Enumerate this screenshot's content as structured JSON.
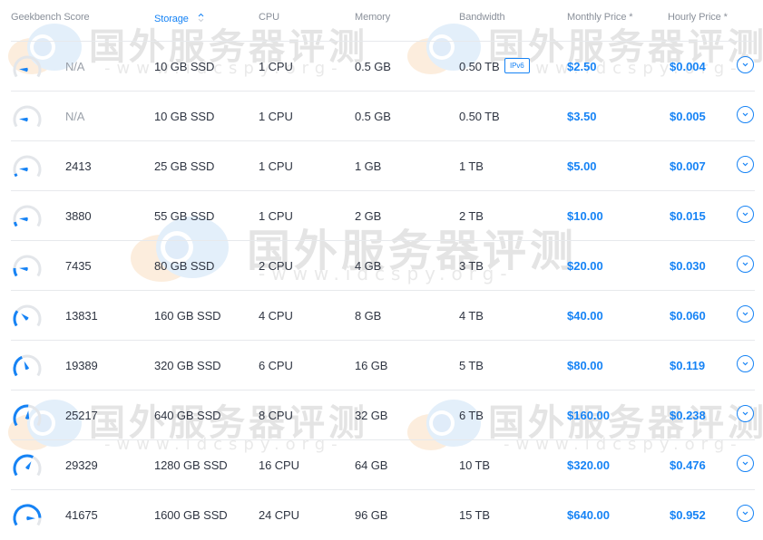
{
  "header": {
    "columns": [
      {
        "label": "Geekbench Score",
        "active": false
      },
      {
        "label": "Storage",
        "active": true,
        "sortable": true
      },
      {
        "label": "CPU",
        "active": false
      },
      {
        "label": "Memory",
        "active": false
      },
      {
        "label": "Bandwidth",
        "active": false
      },
      {
        "label": "Monthly Price *",
        "active": false
      },
      {
        "label": "Hourly Price *",
        "active": false
      }
    ],
    "sort_icon": "sort-updown-icon"
  },
  "rows": [
    {
      "score": "N/A",
      "score_fraction": 0.0,
      "storage": "10 GB SSD",
      "cpu": "1 CPU",
      "memory": "0.5 GB",
      "bandwidth": "0.50 TB",
      "badge": "IPv6",
      "monthly": "$2.50",
      "hourly": "$0.004"
    },
    {
      "score": "N/A",
      "score_fraction": 0.0,
      "storage": "10 GB SSD",
      "cpu": "1 CPU",
      "memory": "0.5 GB",
      "bandwidth": "0.50 TB",
      "badge": "",
      "monthly": "$3.50",
      "hourly": "$0.005"
    },
    {
      "score": "2413",
      "score_fraction": 0.05,
      "storage": "25 GB SSD",
      "cpu": "1 CPU",
      "memory": "1 GB",
      "bandwidth": "1 TB",
      "badge": "",
      "monthly": "$5.00",
      "hourly": "$0.007"
    },
    {
      "score": "3880",
      "score_fraction": 0.08,
      "storage": "55 GB SSD",
      "cpu": "1 CPU",
      "memory": "2 GB",
      "bandwidth": "2 TB",
      "badge": "",
      "monthly": "$10.00",
      "hourly": "$0.015"
    },
    {
      "score": "7435",
      "score_fraction": 0.15,
      "storage": "80 GB SSD",
      "cpu": "2 CPU",
      "memory": "4 GB",
      "bandwidth": "3 TB",
      "badge": "",
      "monthly": "$20.00",
      "hourly": "$0.030"
    },
    {
      "score": "13831",
      "score_fraction": 0.29,
      "storage": "160 GB SSD",
      "cpu": "4 CPU",
      "memory": "8 GB",
      "bandwidth": "4 TB",
      "badge": "",
      "monthly": "$40.00",
      "hourly": "$0.060"
    },
    {
      "score": "19389",
      "score_fraction": 0.4,
      "storage": "320 GB SSD",
      "cpu": "6 CPU",
      "memory": "16 GB",
      "bandwidth": "5 TB",
      "badge": "",
      "monthly": "$80.00",
      "hourly": "$0.119"
    },
    {
      "score": "25217",
      "score_fraction": 0.52,
      "storage": "640 GB SSD",
      "cpu": "8 CPU",
      "memory": "32 GB",
      "bandwidth": "6 TB",
      "badge": "",
      "monthly": "$160.00",
      "hourly": "$0.238"
    },
    {
      "score": "29329",
      "score_fraction": 0.61,
      "storage": "1280 GB SSD",
      "cpu": "16 CPU",
      "memory": "64 GB",
      "bandwidth": "10 TB",
      "badge": "",
      "monthly": "$320.00",
      "hourly": "$0.476"
    },
    {
      "score": "41675",
      "score_fraction": 0.86,
      "storage": "1600 GB SSD",
      "cpu": "24 CPU",
      "memory": "96 GB",
      "bandwidth": "15 TB",
      "badge": "",
      "monthly": "$640.00",
      "hourly": "$0.952"
    }
  ],
  "watermark": {
    "text_cn": "国外服务器评测",
    "text_url": "-www.idcspy.org-"
  },
  "colors": {
    "accent": "#1683f5",
    "gauge_track": "#e3e6ea",
    "text": "#2f3542",
    "muted": "#9ba1aa",
    "header_text": "#8a909a",
    "divider": "#e7e9ec"
  }
}
